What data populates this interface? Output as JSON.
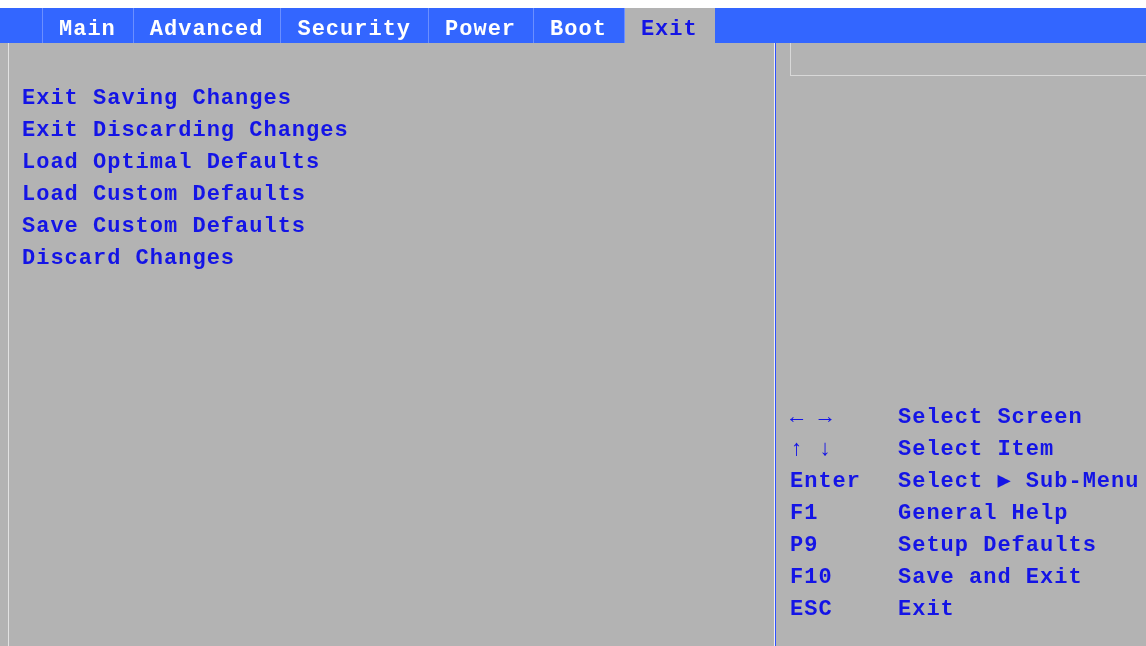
{
  "tabs": [
    {
      "label": "Main",
      "selected": false
    },
    {
      "label": "Advanced",
      "selected": false
    },
    {
      "label": "Security",
      "selected": false
    },
    {
      "label": "Power",
      "selected": false
    },
    {
      "label": "Boot",
      "selected": false
    },
    {
      "label": "Exit",
      "selected": true
    }
  ],
  "menu_items": [
    "Exit Saving Changes",
    "Exit Discarding Changes",
    "Load Optimal Defaults",
    "Load Custom Defaults",
    "Save Custom Defaults",
    "Discard Changes"
  ],
  "help_keys": [
    {
      "key": "← →",
      "action": "Select Screen"
    },
    {
      "key": "↑ ↓",
      "action": "Select Item"
    },
    {
      "key": "Enter",
      "action": "Select ▶ Sub-Menu"
    },
    {
      "key": "F1",
      "action": "General Help"
    },
    {
      "key": "P9",
      "action": "Setup Defaults"
    },
    {
      "key": "F10",
      "action": "Save and Exit"
    },
    {
      "key": "ESC",
      "action": "Exit"
    }
  ]
}
